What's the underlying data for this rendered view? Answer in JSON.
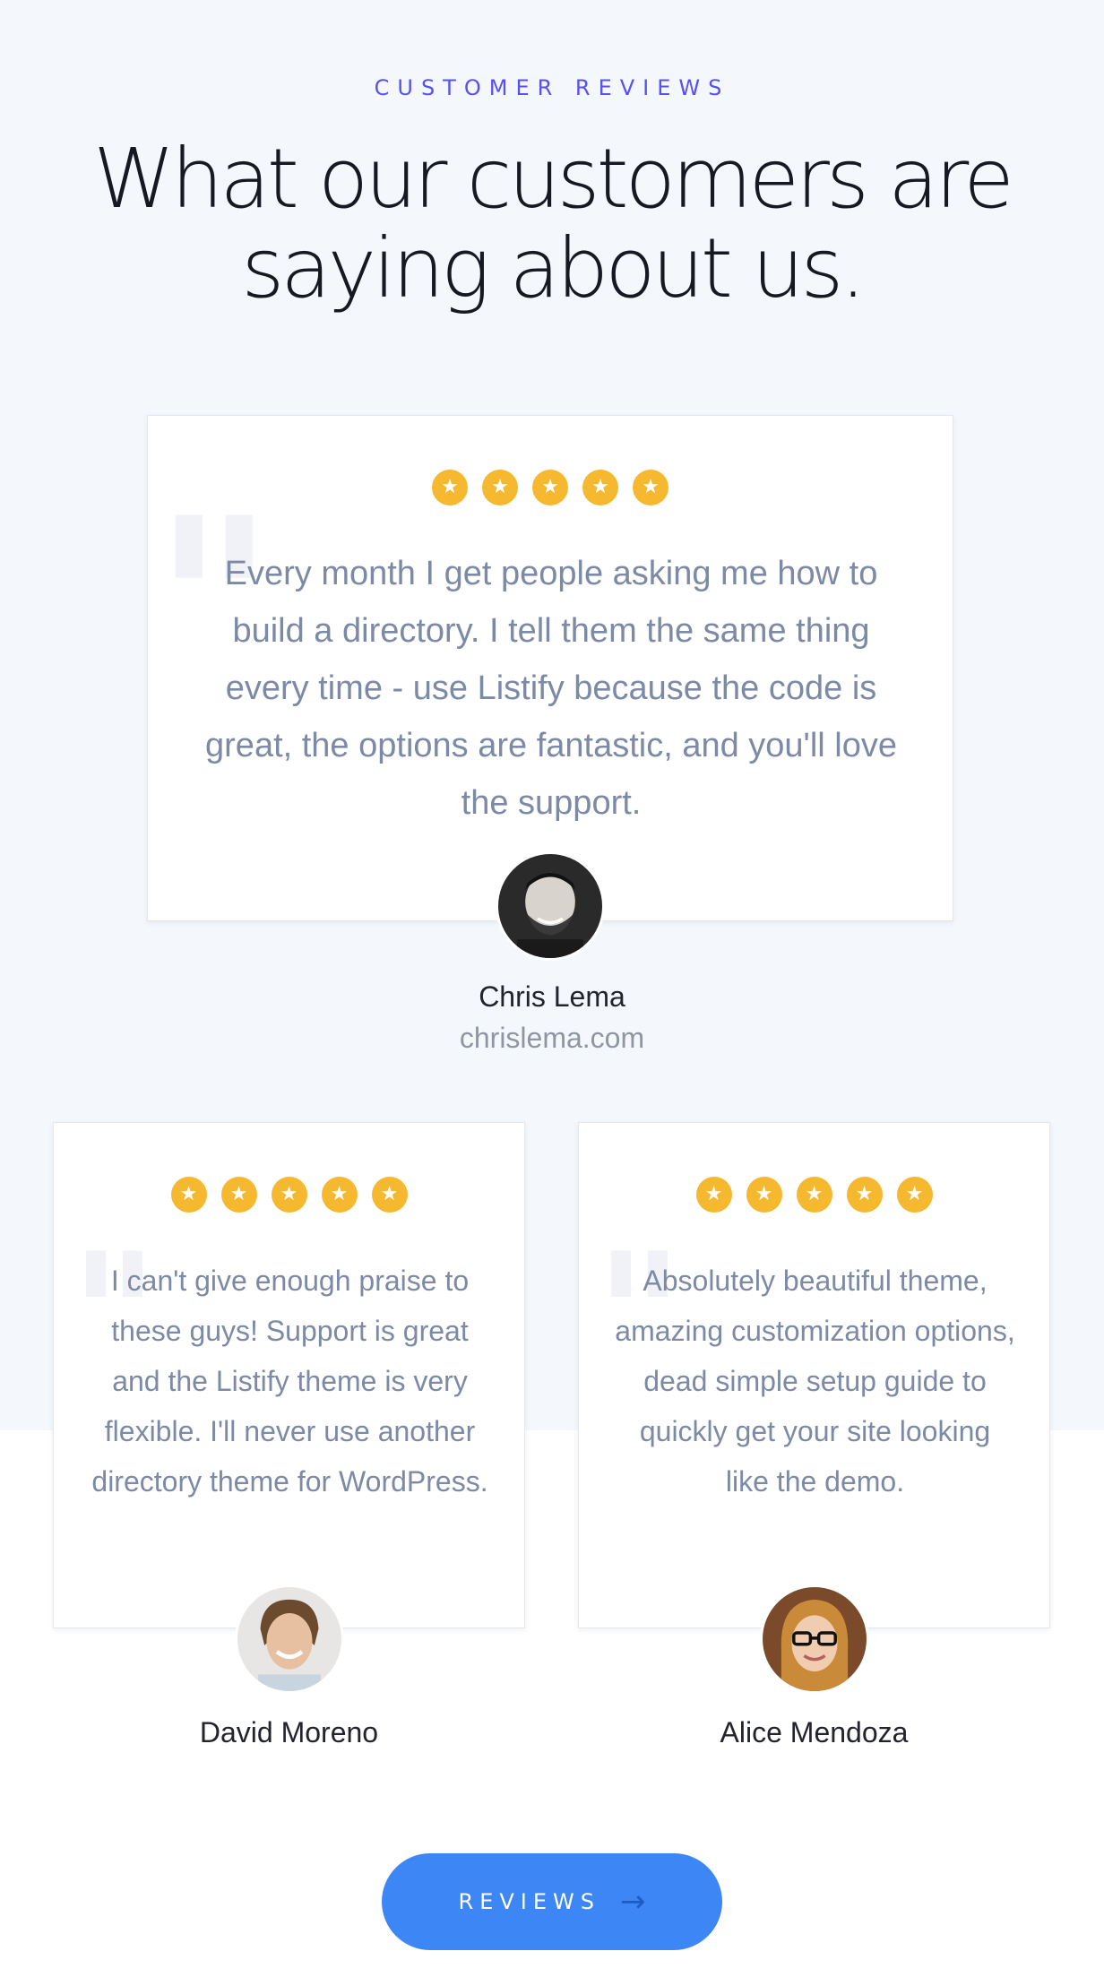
{
  "section": {
    "eyebrow": "CUSTOMER REVIEWS",
    "headline_line1": "What our customers are",
    "headline_line2": "saying about us."
  },
  "reviews": [
    {
      "rating": 5,
      "quote": "Every month I get people asking me how to build a directory. I tell them the same thing every time - use Listify because the code is great, the options are fantastic, and you'll love the support.",
      "name": "Chris Lema",
      "site": "chrislema.com"
    },
    {
      "rating": 5,
      "quote": "I can't give enough praise to these guys! Support is great and the Listify theme is very flexible. I'll never use another directory theme for WordPress.",
      "name": "David Moreno"
    },
    {
      "rating": 5,
      "quote": "Absolutely beautiful theme, amazing customization options, dead simple setup guide to quickly get your site looking like the demo.",
      "name": "Alice Mendoza"
    }
  ],
  "cta": {
    "label": "REVIEWS",
    "icon": "arrow-right-icon"
  },
  "colors": {
    "accent": "#5a50f0",
    "star": "#f5b82e",
    "button": "#3c86f5",
    "quote_text": "#7c8aa6",
    "section_bg": "#f4f8fc"
  }
}
